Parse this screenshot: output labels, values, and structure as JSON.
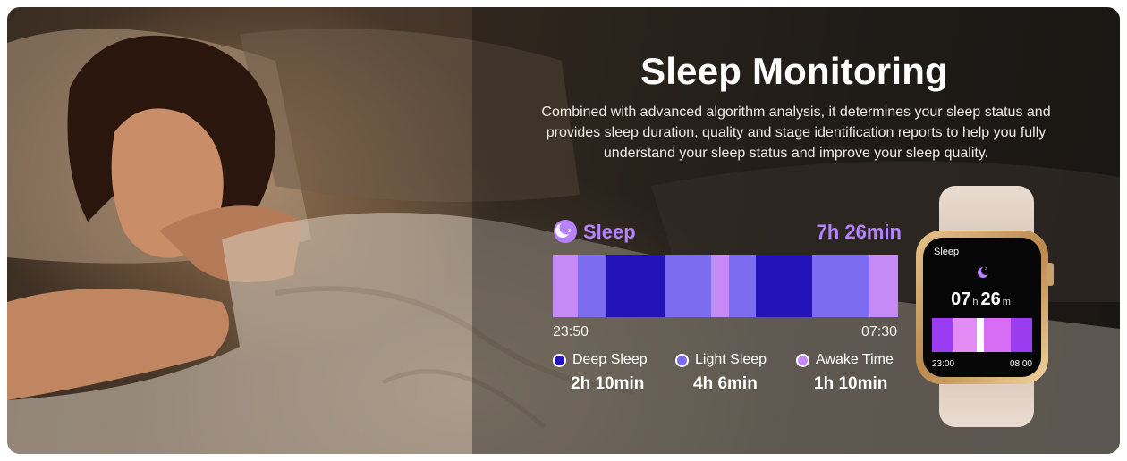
{
  "header": {
    "title": "Sleep Monitoring",
    "description": "Combined with advanced algorithm analysis, it determines your sleep status and provides sleep duration, quality and stage identification reports to help you fully understand your sleep status and improve your sleep quality."
  },
  "sleep_card": {
    "label": "Sleep",
    "total": "7h 26min",
    "start_time": "23:50",
    "end_time": "07:30",
    "legend": [
      {
        "name": "Deep Sleep",
        "value": "2h 10min",
        "color": "#2413b8"
      },
      {
        "name": "Light Sleep",
        "value": "4h 6min",
        "color": "#7b6cf0"
      },
      {
        "name": "Awake Time",
        "value": "1h 10min",
        "color": "#c58af5"
      }
    ]
  },
  "watch": {
    "screen_title": "Sleep",
    "hours": "07",
    "hours_unit": "h",
    "minutes": "26",
    "minutes_unit": "m",
    "start_time": "23:00",
    "end_time": "08:00"
  },
  "colors": {
    "deep": "#2413b8",
    "light": "#7b6cf0",
    "awake": "#c58af5",
    "accent": "#b682ff"
  },
  "icons": [
    "moon-icon",
    "watch-moon-icon"
  ]
}
